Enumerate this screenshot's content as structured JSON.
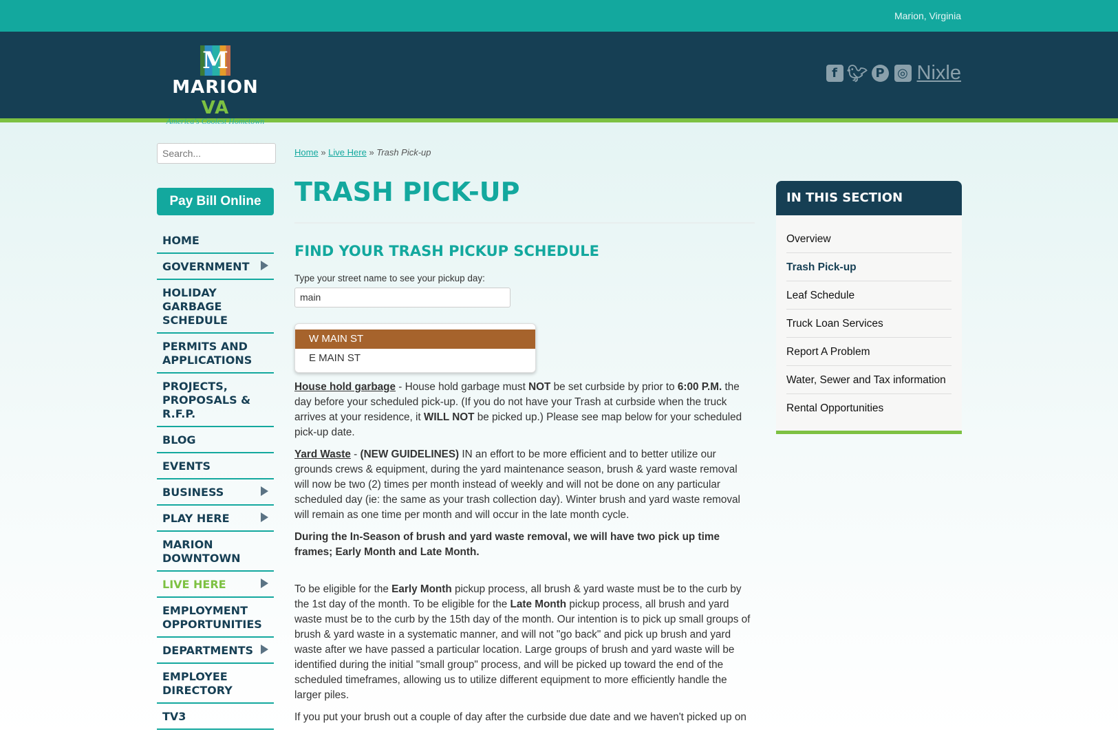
{
  "topbar": {
    "location": "Marion, Virginia"
  },
  "header": {
    "logo": {
      "letter": "M",
      "name_main": "MARION",
      "name_accent": "VA",
      "tagline": "America's Coolest Hometown"
    },
    "social": {
      "icons": [
        "facebook-icon",
        "twitter-icon",
        "pinterest-icon",
        "instagram-icon"
      ],
      "nixle": "Nixle"
    }
  },
  "sidebar": {
    "search_placeholder": "Search...",
    "pay_bill": "Pay Bill Online",
    "nav": [
      {
        "label": "HOME"
      },
      {
        "label": "GOVERNMENT",
        "arrow": true
      },
      {
        "label": "HOLIDAY GARBAGE SCHEDULE"
      },
      {
        "label": "PERMITS AND APPLICATIONS"
      },
      {
        "label": "PROJECTS, PROPOSALS & R.F.P."
      },
      {
        "label": "BLOG"
      },
      {
        "label": "EVENTS"
      },
      {
        "label": "BUSINESS",
        "arrow": true
      },
      {
        "label": "PLAY HERE",
        "arrow": true
      },
      {
        "label": "MARION DOWNTOWN"
      },
      {
        "label": "LIVE HERE",
        "arrow": true,
        "active": true
      },
      {
        "label": "EMPLOYMENT OPPORTUNITIES"
      },
      {
        "label": "DEPARTMENTS",
        "arrow": true
      },
      {
        "label": "EMPLOYEE DIRECTORY"
      },
      {
        "label": "TV3"
      }
    ]
  },
  "breadcrumb": {
    "home": "Home",
    "sep": "»",
    "live_here": "Live Here",
    "current": "Trash Pick-up"
  },
  "main": {
    "title": "TRASH PICK-UP",
    "subtitle": "FIND YOUR TRASH PICKUP SCHEDULE",
    "street_label": "Type your street name to see your pickup day:",
    "street_value": "main",
    "suggestions": [
      "W MAIN ST",
      "E MAIN ST"
    ],
    "p1": {
      "link": "House hold garbage",
      "t1": " - House hold garbage must ",
      "b1": "NOT",
      "t2": " be set curbside by prior to ",
      "b2": "6:00 P.M.",
      "t3": " the day before your scheduled pick-up.  (If you do not have your Trash at curbside when the truck arrives at your residence, it ",
      "b3": "WILL NOT",
      "t4": " be picked up.)  Please see map below for your scheduled pick-up date."
    },
    "p2": {
      "link": "Yard Waste",
      "t1": " -  ",
      "b1": "(NEW GUIDELINES)",
      "t2": " IN an effort to be more efficient and to better utilize our grounds crews & equipment, during the yard maintenance season, brush & yard waste removal will now be two (2) times per month instead of weekly and will not be done on any particular scheduled day (ie: the same as your trash collection day).  Winter brush and yard waste removal will remain as one time per month and will occur in the late month cycle."
    },
    "p3": "During the In-Season of brush and yard waste removal, we will have two pick up time frames; Early Month and Late Month.",
    "p4": {
      "t1": "To be eligible for the ",
      "b1": "Early Month",
      "t2": " pickup process, all brush & yard waste must be to the curb by the 1st day of the month.   To be eligible for the ",
      "b2": "Late Month",
      "t3": " pickup process, all brush and yard waste must be to the curb by the 15th day of the month.  Our intention is to pick up small groups of brush &  yard waste in a systematic manner, and will not \"go back\" and pick up brush and yard waste after we have passed a particular location.  Large groups of brush and yard waste will be identified during the initial \"small group\" process, and will be picked up toward the end of the scheduled timeframes, allowing us to utilize different equipment to more efficiently handle the larger piles."
    },
    "p5": "If you put your brush out a couple of day after the curbside due date and we haven't picked up on"
  },
  "section": {
    "title": "IN THIS SECTION",
    "items": [
      "Overview",
      "Trash Pick-up",
      "Leaf Schedule",
      "Truck Loan Services",
      "Report A Problem",
      "Water, Sewer and Tax information",
      "Rental Opportunities"
    ],
    "current": "Trash Pick-up"
  },
  "colors": {
    "teal": "#13a89e",
    "navy": "#163f54",
    "green": "#7dc142",
    "highlight": "#a6632c"
  }
}
